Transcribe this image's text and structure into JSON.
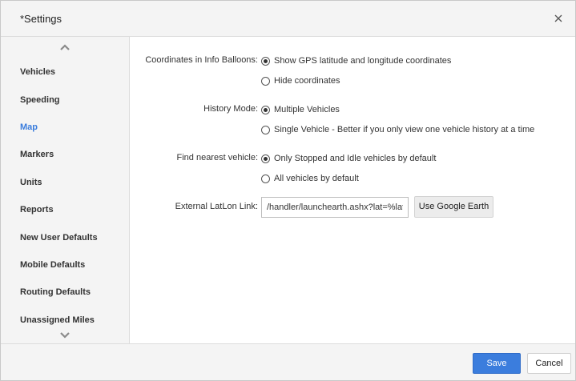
{
  "dialog": {
    "title": "*Settings",
    "close_icon": "close-icon"
  },
  "sidebar": {
    "scroll_up_icon": "chevron-up-icon",
    "scroll_down_icon": "chevron-down-icon",
    "active_color": "#3b7ddd",
    "items": [
      {
        "label": "Vehicles",
        "active": false
      },
      {
        "label": "Speeding",
        "active": false
      },
      {
        "label": "Map",
        "active": true
      },
      {
        "label": "Markers",
        "active": false
      },
      {
        "label": "Units",
        "active": false
      },
      {
        "label": "Reports",
        "active": false
      },
      {
        "label": "New User Defaults",
        "active": false
      },
      {
        "label": "Mobile Defaults",
        "active": false
      },
      {
        "label": "Routing Defaults",
        "active": false
      },
      {
        "label": "Unassigned Miles",
        "active": false
      }
    ]
  },
  "settings": {
    "coordinates": {
      "label": "Coordinates in Info Balloons:",
      "options": [
        {
          "label": "Show GPS latitude and longitude coordinates",
          "selected": true
        },
        {
          "label": "Hide coordinates",
          "selected": false
        }
      ]
    },
    "history_mode": {
      "label": "History Mode:",
      "options": [
        {
          "label": "Multiple Vehicles",
          "selected": true
        },
        {
          "label": "Single Vehicle - Better if you only view one vehicle history at a time",
          "selected": false
        }
      ]
    },
    "nearest_vehicle": {
      "label": "Find nearest vehicle:",
      "options": [
        {
          "label": "Only Stopped and Idle vehicles by default",
          "selected": true
        },
        {
          "label": "All vehicles by default",
          "selected": false
        }
      ]
    },
    "external_link": {
      "label": "External LatLon Link:",
      "value": "/handler/launchearth.ashx?lat=%lat%&",
      "button_label": "Use Google Earth"
    }
  },
  "footer": {
    "save_label": "Save",
    "cancel_label": "Cancel",
    "save_color": "#3b7ddd"
  }
}
